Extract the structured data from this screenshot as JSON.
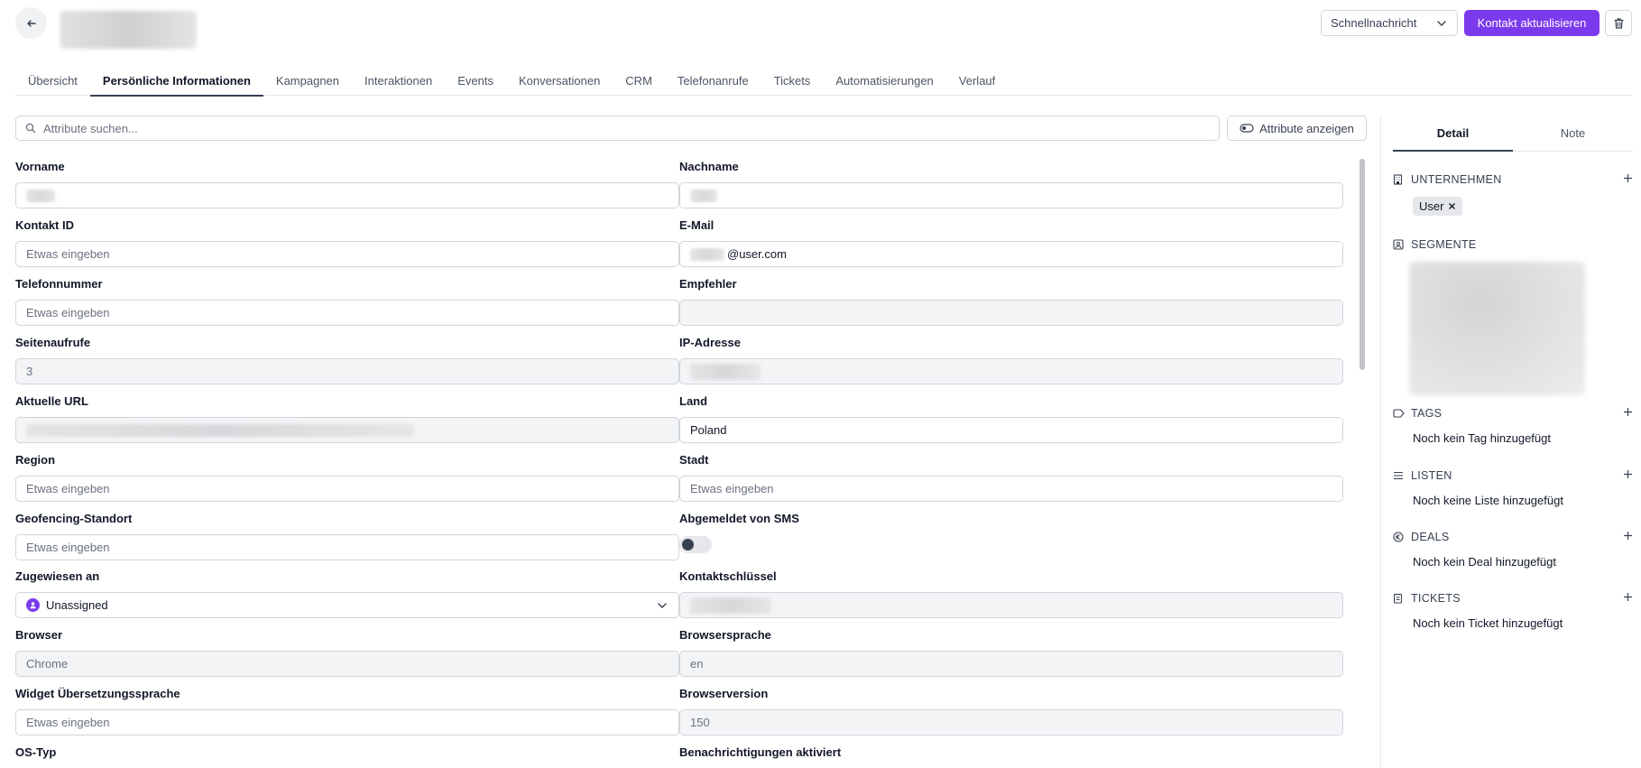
{
  "header": {
    "quick_message": "Schnellnachricht",
    "update_contact": "Kontakt aktualisieren"
  },
  "tabs": [
    {
      "label": "Übersicht"
    },
    {
      "label": "Persönliche Informationen"
    },
    {
      "label": "Kampagnen"
    },
    {
      "label": "Interaktionen"
    },
    {
      "label": "Events"
    },
    {
      "label": "Konversationen"
    },
    {
      "label": "CRM"
    },
    {
      "label": "Telefonanrufe"
    },
    {
      "label": "Tickets"
    },
    {
      "label": "Automatisierungen"
    },
    {
      "label": "Verlauf"
    }
  ],
  "search": {
    "placeholder": "Attribute suchen...",
    "show_attributes": "Attribute anzeigen"
  },
  "fields": {
    "first_name": {
      "label": "Vorname"
    },
    "last_name": {
      "label": "Nachname"
    },
    "contact_id": {
      "label": "Kontakt ID",
      "placeholder": "Etwas eingeben"
    },
    "email": {
      "label": "E-Mail",
      "value": "@user.com"
    },
    "phone": {
      "label": "Telefonnummer",
      "placeholder": "Etwas eingeben"
    },
    "referrer": {
      "label": "Empfehler"
    },
    "page_views": {
      "label": "Seitenaufrufe",
      "value": "3"
    },
    "ip": {
      "label": "IP-Adresse"
    },
    "current_url": {
      "label": "Aktuelle URL"
    },
    "country": {
      "label": "Land",
      "value": "Poland"
    },
    "region": {
      "label": "Region",
      "placeholder": "Etwas eingeben"
    },
    "city": {
      "label": "Stadt",
      "placeholder": "Etwas eingeben"
    },
    "geofence": {
      "label": "Geofencing-Standort",
      "placeholder": "Etwas eingeben"
    },
    "sms_unsub": {
      "label": "Abgemeldet von SMS"
    },
    "assigned": {
      "label": "Zugewiesen an",
      "value": "Unassigned"
    },
    "contact_key": {
      "label": "Kontaktschlüssel"
    },
    "browser": {
      "label": "Browser",
      "value": "Chrome"
    },
    "browser_lang": {
      "label": "Browsersprache",
      "value": "en"
    },
    "widget_lang": {
      "label": "Widget Übersetzungssprache",
      "placeholder": "Etwas eingeben"
    },
    "browser_version": {
      "label": "Browserversion",
      "value": "150"
    },
    "os_type": {
      "label": "OS-Typ"
    },
    "notifications": {
      "label": "Benachrichtigungen aktiviert"
    }
  },
  "right_panel": {
    "tabs": [
      {
        "label": "Detail"
      },
      {
        "label": "Note"
      }
    ],
    "company": {
      "title": "UNTERNEHMEN",
      "chip": "User"
    },
    "segments": {
      "title": "SEGMENTE"
    },
    "tags": {
      "title": "TAGS",
      "empty": "Noch kein Tag hinzugefügt"
    },
    "lists": {
      "title": "LISTEN",
      "empty": "Noch keine Liste hinzugefügt"
    },
    "deals": {
      "title": "DEALS",
      "empty": "Noch kein Deal hinzugefügt"
    },
    "tickets": {
      "title": "TICKETS",
      "empty": "Noch kein Ticket hinzugefügt"
    }
  },
  "colors": {
    "accent": "#7c3aed",
    "border": "#d1d5db",
    "disabled_bg": "#f3f4f6"
  }
}
